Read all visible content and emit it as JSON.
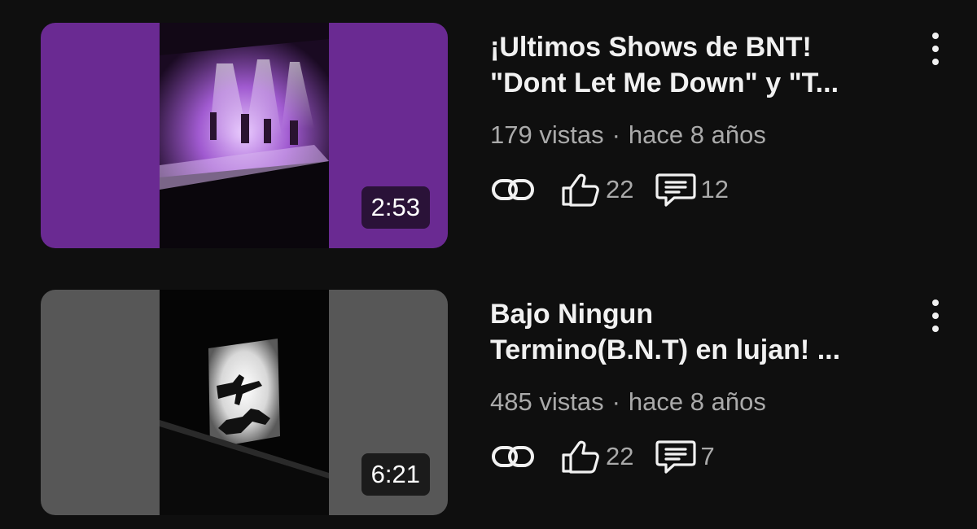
{
  "videos": [
    {
      "title_line1": "¡Ultimos Shows de BNT!",
      "title_line2": "\"Dont Let Me Down\" y \"T...",
      "views": "179 vistas",
      "separator": "·",
      "age": "hace 8 años",
      "duration": "2:53",
      "likes": "22",
      "comments": "12",
      "thumb_color": "#6a2a92"
    },
    {
      "title_line1": "Bajo Ningun",
      "title_line2": "Termino(B.N.T) en lujan! ...",
      "views": "485 vistas",
      "separator": "·",
      "age": "hace 8 años",
      "duration": "6:21",
      "likes": "22",
      "comments": "7",
      "thumb_color": "#575757"
    }
  ],
  "icons": {
    "link": "link-icon",
    "like": "thumbs-up-icon",
    "comment": "comment-icon",
    "more": "more-vertical-icon"
  }
}
